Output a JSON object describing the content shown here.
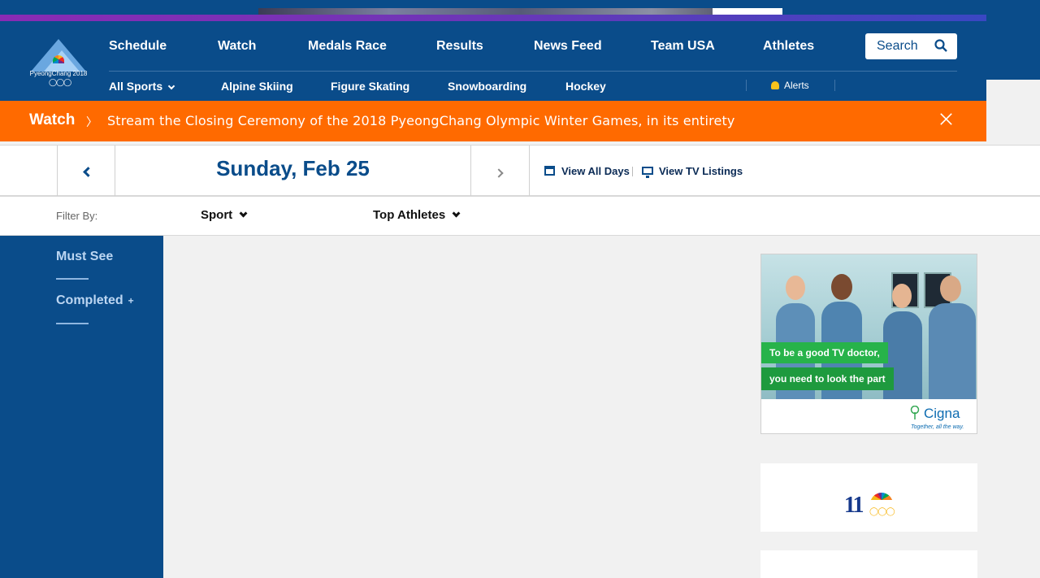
{
  "logo": {
    "text": "PyeongChang 2018"
  },
  "nav": {
    "items": [
      "Schedule",
      "Watch",
      "Medals Race",
      "Results",
      "News Feed",
      "Team USA",
      "Athletes"
    ],
    "search_label": "Search"
  },
  "subnav": {
    "items": [
      "All Sports",
      "Alpine Skiing",
      "Figure Skating",
      "Snowboarding",
      "Hockey"
    ],
    "alerts": "Alerts"
  },
  "banner": {
    "label": "Watch",
    "message": "Stream the Closing Ceremony of the 2018 PyeongChang Olympic Winter Games, in its entirety"
  },
  "datebar": {
    "date": "Sunday, Feb 25",
    "view_all_days": "View All Days",
    "view_tv": "View TV Listings"
  },
  "filter": {
    "label": "Filter By:",
    "sport": "Sport",
    "athletes": "Top Athletes"
  },
  "sidebar": {
    "items": [
      "Must See",
      "Completed"
    ],
    "completed_plus": "+"
  },
  "ad": {
    "line1": "To be a good TV doctor,",
    "line2": "you need to look the part",
    "brand": "Cigna",
    "tagline": "Together, all the way."
  },
  "card2": {
    "logo_text": "11"
  },
  "colors": {
    "brand_blue": "#0a4c8a",
    "banner_orange": "#ff6a00",
    "ad_green": "#27b34a"
  }
}
